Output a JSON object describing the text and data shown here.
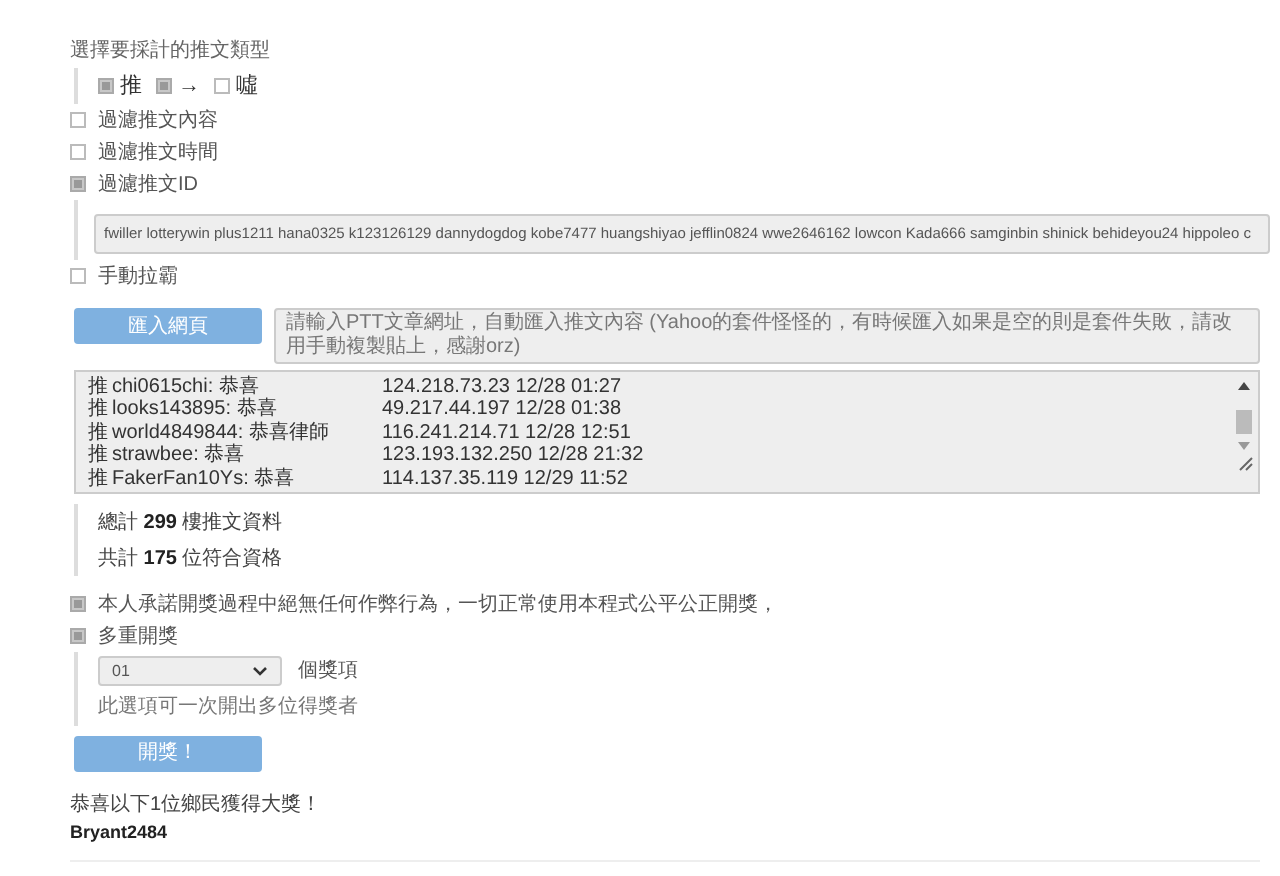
{
  "push_type": {
    "title": "選擇要採計的推文類型",
    "options": [
      {
        "label": "推",
        "checked": true
      },
      {
        "label": "→",
        "checked": true
      },
      {
        "label": "噓",
        "checked": false
      }
    ]
  },
  "filters": [
    {
      "label": "過濾推文內容",
      "checked": false
    },
    {
      "label": "過濾推文時間",
      "checked": false
    },
    {
      "label": "過濾推文ID",
      "checked": true
    }
  ],
  "id_filter": {
    "value": "fwiller lotterywin plus1211 hana0325 k123126129 dannydogdog kobe7477 huangshiyao jefflin0824 wwe2646162 lowcon Kada666 samginbin shinick behideyou24 hippoleo c"
  },
  "manual": {
    "label": "手動拉霸",
    "checked": false
  },
  "import_button": "匯入網頁",
  "url_field": {
    "placeholder": "請輸入PTT文章網址，自動匯入推文內容 (Yahoo的套件怪怪的，有時候匯入如果是空的則是套件失敗，請改用手動複製貼上，感謝orz)"
  },
  "comments": [
    {
      "tag": "推",
      "text": "chi0615chi: 恭喜",
      "meta": "124.218.73.23 12/28 01:27"
    },
    {
      "tag": "推",
      "text": "looks143895: 恭喜",
      "meta": "49.217.44.197 12/28 01:38"
    },
    {
      "tag": "推",
      "text": "world4849844: 恭喜律師",
      "meta": "116.241.214.71 12/28 12:51"
    },
    {
      "tag": "推",
      "text": "strawbee: 恭喜",
      "meta": "123.193.132.250 12/28 21:32"
    },
    {
      "tag": "推",
      "text": "FakerFan10Ys: 恭喜",
      "meta": "114.137.35.119 12/29 11:52"
    }
  ],
  "totals": [
    "總計 **299** 樓推文資料",
    "共計 **175** 位符合資格"
  ],
  "promise": {
    "label": "本人承諾開獎過程中絕無任何作弊行為，一切正常使用本程式公平公正開獎，",
    "checked": true
  },
  "multi": {
    "label": "多重開獎",
    "checked": true,
    "select_value": "01",
    "unit": "個獎項",
    "hint": "此選項可一次開出多位得獎者"
  },
  "draw_button": "開獎！",
  "result": {
    "message": "恭喜以下1位鄉民獲得大獎！",
    "winners": [
      "Bryant2484"
    ]
  }
}
